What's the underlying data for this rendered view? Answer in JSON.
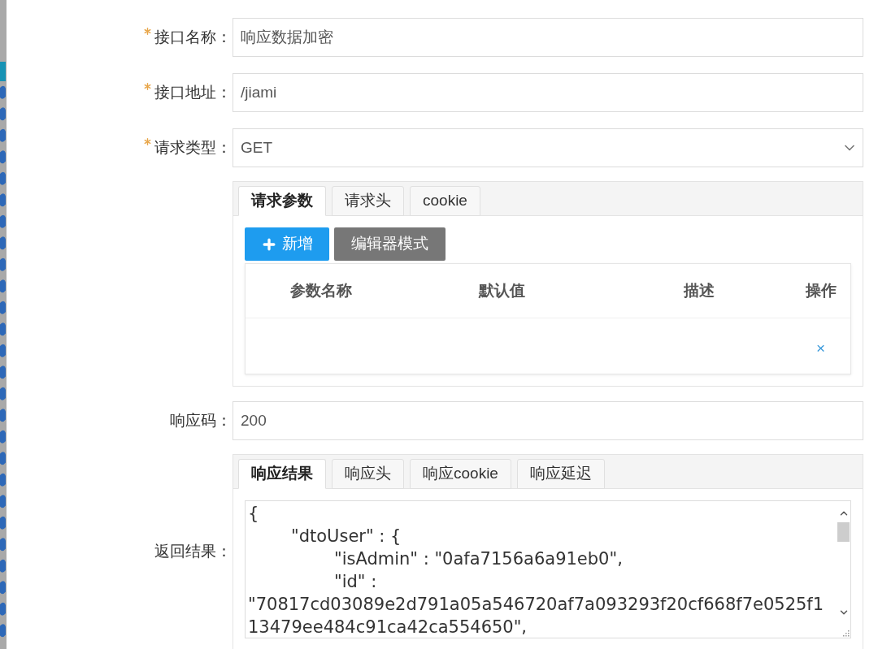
{
  "form_fields": [
    {
      "label": "接口名称：",
      "required": true,
      "kind": "input",
      "value": "响应数据加密"
    },
    {
      "label": "接口地址：",
      "required": true,
      "kind": "input",
      "value": "/jiami"
    },
    {
      "label": "请求类型：",
      "required": true,
      "kind": "select",
      "value": "GET"
    }
  ],
  "request_panel": {
    "tabs": [
      {
        "label": "请求参数",
        "selected": true
      },
      {
        "label": "请求头",
        "selected": false
      },
      {
        "label": "cookie",
        "selected": false
      }
    ],
    "buttons": [
      {
        "label": "新增",
        "kind": "primary"
      },
      {
        "label": "编辑器模式",
        "kind": "secondary"
      }
    ],
    "table": {
      "columns": [
        "参数名称",
        "默认值",
        "描述",
        "操作"
      ],
      "rows": [
        {
          "action": "×"
        }
      ]
    }
  },
  "response_code": {
    "label": "响应码：",
    "value": "200"
  },
  "response_panel": {
    "label": "返回结果：",
    "tabs": [
      {
        "label": "响应结果",
        "selected": true
      },
      {
        "label": "响应头",
        "selected": false
      },
      {
        "label": "响应cookie",
        "selected": false
      },
      {
        "label": "响应延迟",
        "selected": false
      }
    ],
    "body_lines": [
      "{",
      "\t\"dtoUser\" : {",
      "\t\t\"isAdmin\" : \"0afa7156a6a91eb0\",",
      "\t\t\"id\" :",
      "\"70817cd03089e2d791a05a546720af7a093293f20cf668f7e0525f1",
      "13479ee484c91ca42ca554650\","
    ]
  }
}
